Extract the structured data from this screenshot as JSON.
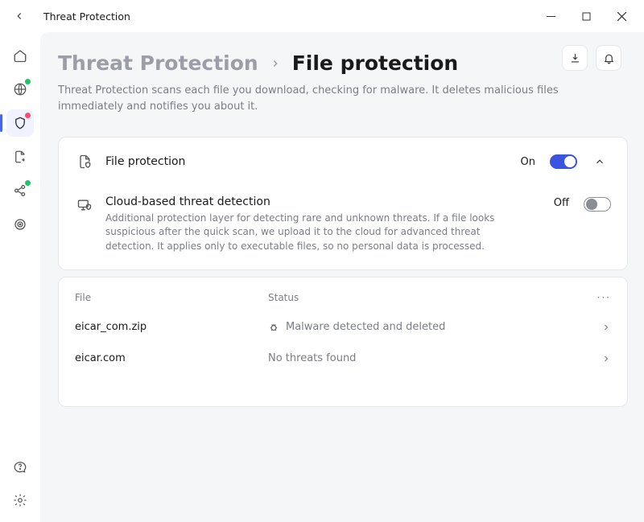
{
  "window": {
    "title": "Threat Protection"
  },
  "breadcrumb": {
    "root": "Threat Protection",
    "current": "File protection"
  },
  "subtitle": "Threat Protection scans each file you download, checking for malware. It deletes malicious files immediately and notifies you about it.",
  "settings": {
    "file_protection": {
      "title": "File protection",
      "state_label": "On",
      "on": true
    },
    "cloud_detection": {
      "title": "Cloud-based threat detection",
      "desc": "Additional protection layer for detecting rare and unknown threats. If a file looks suspicious after the quick scan, we upload it to the cloud for advanced threat detection. It applies only to executable files, so no personal data is processed.",
      "state_label": "Off",
      "on": false
    }
  },
  "table": {
    "columns": {
      "file": "File",
      "status": "Status"
    },
    "rows": [
      {
        "file": "eicar_com.zip",
        "status": "Malware detected and deleted",
        "threat": true
      },
      {
        "file": "eicar.com",
        "status": "No threats found",
        "threat": false
      }
    ]
  },
  "icons": {
    "back": "back-arrow",
    "minimize": "minimize",
    "maximize": "maximize",
    "close": "close",
    "download": "download",
    "bell": "bell",
    "home": "home",
    "globe": "globe",
    "shield": "shield",
    "file-arrow": "file-arrow",
    "share": "share",
    "target": "target",
    "help": "help",
    "gear": "gear",
    "file-shield": "file-shield",
    "monitor-shield": "monitor-shield",
    "bug": "bug",
    "chev-up": "chevron-up",
    "chev-right": "chevron-right"
  }
}
